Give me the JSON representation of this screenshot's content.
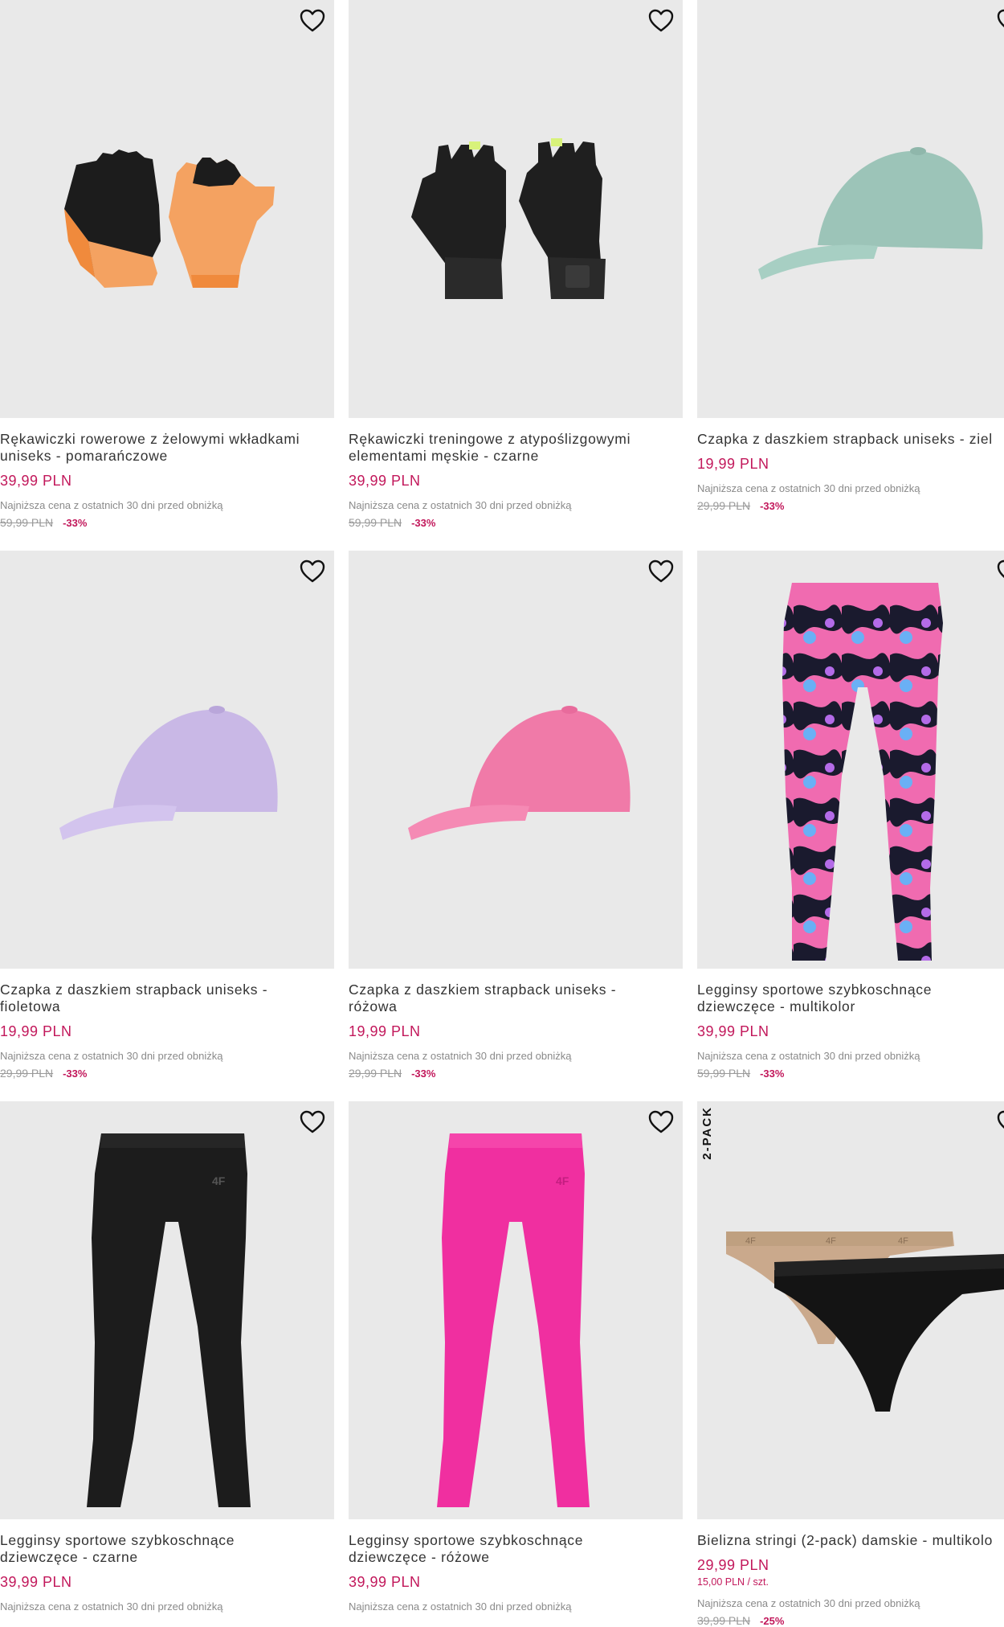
{
  "products": [
    {
      "title_lines": [
        "Rękawiczki rowerowe z żelowymi wkładkami",
        "uniseks - pomarańczowe"
      ],
      "price": "39,99 PLN",
      "unit_price": "",
      "lowest_label": "Najniższa cena z ostatnich 30 dni przed obniżką",
      "old_price": "59,99 PLN",
      "discount": "-33%",
      "badge": "",
      "image": "gloves-orange-icon"
    },
    {
      "title_lines": [
        "Rękawiczki treningowe z atypoślizgowymi",
        "elementami męskie - czarne"
      ],
      "price": "39,99 PLN",
      "unit_price": "",
      "lowest_label": "Najniższa cena z ostatnich 30 dni przed obniżką",
      "old_price": "59,99 PLN",
      "discount": "-33%",
      "badge": "",
      "image": "gloves-black-icon"
    },
    {
      "title_lines": [
        "Czapka z daszkiem strapback uniseks - ziel"
      ],
      "price": "19,99 PLN",
      "unit_price": "",
      "lowest_label": "Najniższa cena z ostatnich 30 dni przed obniżką",
      "old_price": "29,99 PLN",
      "discount": "-33%",
      "badge": "",
      "image": "cap-mint-icon"
    },
    {
      "title_lines": [
        "Czapka z daszkiem strapback uniseks -",
        "fioletowa"
      ],
      "price": "19,99 PLN",
      "unit_price": "",
      "lowest_label": "Najniższa cena z ostatnich 30 dni przed obniżką",
      "old_price": "29,99 PLN",
      "discount": "-33%",
      "badge": "",
      "image": "cap-lilac-icon"
    },
    {
      "title_lines": [
        "Czapka z daszkiem strapback uniseks -",
        "różowa"
      ],
      "price": "19,99 PLN",
      "unit_price": "",
      "lowest_label": "Najniższa cena z ostatnich 30 dni przed obniżką",
      "old_price": "29,99 PLN",
      "discount": "-33%",
      "badge": "",
      "image": "cap-pink-icon"
    },
    {
      "title_lines": [
        "Legginsy sportowe szybkoschnące",
        "dziewczęce - multikolor"
      ],
      "price": "39,99 PLN",
      "unit_price": "",
      "lowest_label": "Najniższa cena z ostatnich 30 dni przed obniżką",
      "old_price": "59,99 PLN",
      "discount": "-33%",
      "badge": "",
      "image": "leggings-print-icon"
    },
    {
      "title_lines": [
        "Legginsy sportowe szybkoschnące",
        "dziewczęce - czarne"
      ],
      "price": "39,99 PLN",
      "unit_price": "",
      "lowest_label": "Najniższa cena z ostatnich 30 dni przed obniżką",
      "old_price": "",
      "discount": "",
      "badge": "",
      "image": "leggings-black-icon"
    },
    {
      "title_lines": [
        "Legginsy sportowe szybkoschnące",
        "dziewczęce - różowe"
      ],
      "price": "39,99 PLN",
      "unit_price": "",
      "lowest_label": "Najniższa cena z ostatnich 30 dni przed obniżką",
      "old_price": "",
      "discount": "",
      "badge": "",
      "image": "leggings-pink-icon"
    },
    {
      "title_lines": [
        "Bielizna stringi (2-pack) damskie - multikolo"
      ],
      "price": "29,99 PLN",
      "unit_price": "15,00 PLN / szt.",
      "lowest_label": "Najniższa cena z ostatnich 30 dni przed obniżką",
      "old_price": "39,99 PLN",
      "discount": "-25%",
      "badge": "2-PACK",
      "image": "thongs-icon"
    }
  ],
  "colors": {
    "accent": "#c2185b",
    "image_bg": "#e9e9e9"
  }
}
